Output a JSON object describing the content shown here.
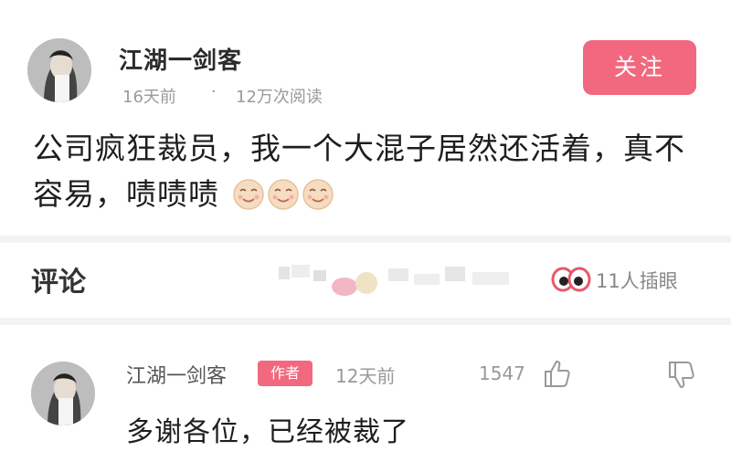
{
  "post": {
    "author": "江湖一剑客",
    "time": "16天前",
    "separator": "·",
    "views": "12万次阅读",
    "follow_label": "关注",
    "text": "公司疯狂裁员，我一个大混子居然还活着，真不容易，啧啧啧",
    "emoji_icon": "smiling-face-emoji"
  },
  "comments_bar": {
    "title": "评论",
    "insert_count": "11人插眼",
    "insert_icon": "eyes-icon"
  },
  "comment": {
    "author": "江湖一剑客",
    "badge": "作者",
    "time": "12天前",
    "likes": "1547",
    "text": "多谢各位，已经被裁了"
  },
  "colors": {
    "accent": "#f2687e",
    "background": "#f3f3f3",
    "card": "#ffffff"
  }
}
